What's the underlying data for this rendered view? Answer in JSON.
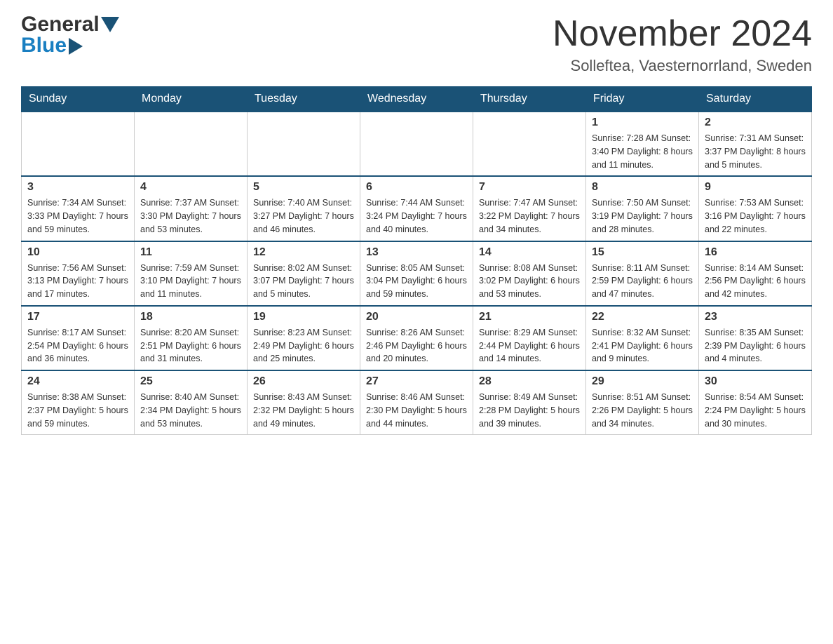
{
  "header": {
    "logo": {
      "general": "General",
      "blue": "Blue"
    },
    "title": "November 2024",
    "location": "Solleftea, Vaesternorrland, Sweden"
  },
  "calendar": {
    "days_of_week": [
      "Sunday",
      "Monday",
      "Tuesday",
      "Wednesday",
      "Thursday",
      "Friday",
      "Saturday"
    ],
    "weeks": [
      [
        {
          "day": "",
          "info": ""
        },
        {
          "day": "",
          "info": ""
        },
        {
          "day": "",
          "info": ""
        },
        {
          "day": "",
          "info": ""
        },
        {
          "day": "",
          "info": ""
        },
        {
          "day": "1",
          "info": "Sunrise: 7:28 AM\nSunset: 3:40 PM\nDaylight: 8 hours\nand 11 minutes."
        },
        {
          "day": "2",
          "info": "Sunrise: 7:31 AM\nSunset: 3:37 PM\nDaylight: 8 hours\nand 5 minutes."
        }
      ],
      [
        {
          "day": "3",
          "info": "Sunrise: 7:34 AM\nSunset: 3:33 PM\nDaylight: 7 hours\nand 59 minutes."
        },
        {
          "day": "4",
          "info": "Sunrise: 7:37 AM\nSunset: 3:30 PM\nDaylight: 7 hours\nand 53 minutes."
        },
        {
          "day": "5",
          "info": "Sunrise: 7:40 AM\nSunset: 3:27 PM\nDaylight: 7 hours\nand 46 minutes."
        },
        {
          "day": "6",
          "info": "Sunrise: 7:44 AM\nSunset: 3:24 PM\nDaylight: 7 hours\nand 40 minutes."
        },
        {
          "day": "7",
          "info": "Sunrise: 7:47 AM\nSunset: 3:22 PM\nDaylight: 7 hours\nand 34 minutes."
        },
        {
          "day": "8",
          "info": "Sunrise: 7:50 AM\nSunset: 3:19 PM\nDaylight: 7 hours\nand 28 minutes."
        },
        {
          "day": "9",
          "info": "Sunrise: 7:53 AM\nSunset: 3:16 PM\nDaylight: 7 hours\nand 22 minutes."
        }
      ],
      [
        {
          "day": "10",
          "info": "Sunrise: 7:56 AM\nSunset: 3:13 PM\nDaylight: 7 hours\nand 17 minutes."
        },
        {
          "day": "11",
          "info": "Sunrise: 7:59 AM\nSunset: 3:10 PM\nDaylight: 7 hours\nand 11 minutes."
        },
        {
          "day": "12",
          "info": "Sunrise: 8:02 AM\nSunset: 3:07 PM\nDaylight: 7 hours\nand 5 minutes."
        },
        {
          "day": "13",
          "info": "Sunrise: 8:05 AM\nSunset: 3:04 PM\nDaylight: 6 hours\nand 59 minutes."
        },
        {
          "day": "14",
          "info": "Sunrise: 8:08 AM\nSunset: 3:02 PM\nDaylight: 6 hours\nand 53 minutes."
        },
        {
          "day": "15",
          "info": "Sunrise: 8:11 AM\nSunset: 2:59 PM\nDaylight: 6 hours\nand 47 minutes."
        },
        {
          "day": "16",
          "info": "Sunrise: 8:14 AM\nSunset: 2:56 PM\nDaylight: 6 hours\nand 42 minutes."
        }
      ],
      [
        {
          "day": "17",
          "info": "Sunrise: 8:17 AM\nSunset: 2:54 PM\nDaylight: 6 hours\nand 36 minutes."
        },
        {
          "day": "18",
          "info": "Sunrise: 8:20 AM\nSunset: 2:51 PM\nDaylight: 6 hours\nand 31 minutes."
        },
        {
          "day": "19",
          "info": "Sunrise: 8:23 AM\nSunset: 2:49 PM\nDaylight: 6 hours\nand 25 minutes."
        },
        {
          "day": "20",
          "info": "Sunrise: 8:26 AM\nSunset: 2:46 PM\nDaylight: 6 hours\nand 20 minutes."
        },
        {
          "day": "21",
          "info": "Sunrise: 8:29 AM\nSunset: 2:44 PM\nDaylight: 6 hours\nand 14 minutes."
        },
        {
          "day": "22",
          "info": "Sunrise: 8:32 AM\nSunset: 2:41 PM\nDaylight: 6 hours\nand 9 minutes."
        },
        {
          "day": "23",
          "info": "Sunrise: 8:35 AM\nSunset: 2:39 PM\nDaylight: 6 hours\nand 4 minutes."
        }
      ],
      [
        {
          "day": "24",
          "info": "Sunrise: 8:38 AM\nSunset: 2:37 PM\nDaylight: 5 hours\nand 59 minutes."
        },
        {
          "day": "25",
          "info": "Sunrise: 8:40 AM\nSunset: 2:34 PM\nDaylight: 5 hours\nand 53 minutes."
        },
        {
          "day": "26",
          "info": "Sunrise: 8:43 AM\nSunset: 2:32 PM\nDaylight: 5 hours\nand 49 minutes."
        },
        {
          "day": "27",
          "info": "Sunrise: 8:46 AM\nSunset: 2:30 PM\nDaylight: 5 hours\nand 44 minutes."
        },
        {
          "day": "28",
          "info": "Sunrise: 8:49 AM\nSunset: 2:28 PM\nDaylight: 5 hours\nand 39 minutes."
        },
        {
          "day": "29",
          "info": "Sunrise: 8:51 AM\nSunset: 2:26 PM\nDaylight: 5 hours\nand 34 minutes."
        },
        {
          "day": "30",
          "info": "Sunrise: 8:54 AM\nSunset: 2:24 PM\nDaylight: 5 hours\nand 30 minutes."
        }
      ]
    ]
  }
}
